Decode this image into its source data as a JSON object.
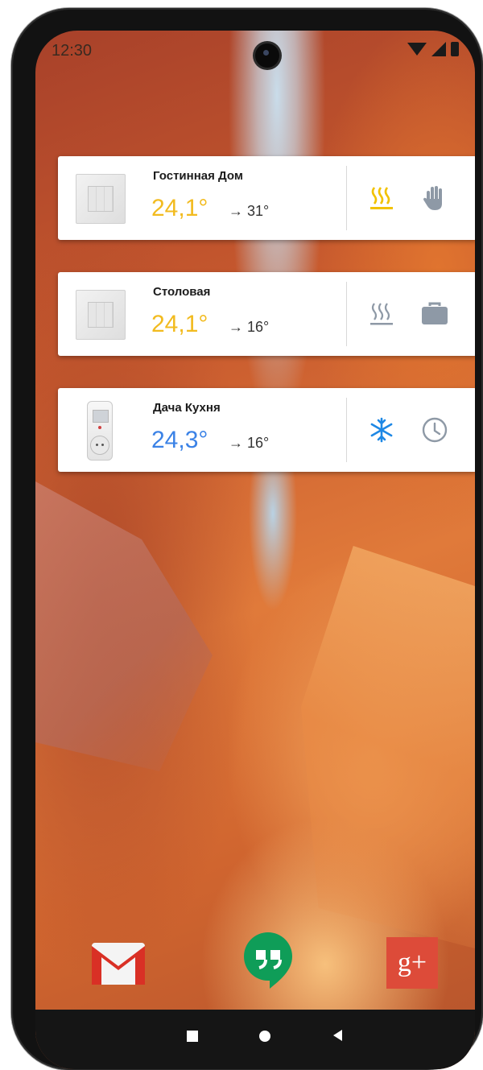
{
  "status_bar": {
    "time": "12:30",
    "icons": [
      "camera-icon",
      "wifi-icon",
      "signal-icon",
      "battery-icon"
    ]
  },
  "widgets": [
    {
      "name": "Гостинная Дом",
      "current_temp": "24,1°",
      "target_temp": "→ 31°",
      "device": "thermostat-panel",
      "mode_icon": "heating-icon",
      "mode_color": "#f2c200",
      "schedule_icon": "hand-icon",
      "temp_color": "#f2bb1f"
    },
    {
      "name": "Столовая",
      "current_temp": "24,1°",
      "target_temp": "→ 16°",
      "device": "thermostat-panel",
      "mode_icon": "heating-icon",
      "mode_color": "#8e99a6",
      "schedule_icon": "briefcase-icon",
      "temp_color": "#f2bb1f"
    },
    {
      "name": "Дача Кухня",
      "current_temp": "24,3°",
      "target_temp": "→ 16°",
      "device": "smart-plug",
      "mode_icon": "snowflake-icon",
      "mode_color": "#1e88e5",
      "schedule_icon": "clock-icon",
      "temp_color": "#3b82e6"
    }
  ],
  "dock": {
    "apps": [
      "gmail-icon",
      "hangouts-icon",
      "google-plus-icon"
    ],
    "google_plus_label": "g+"
  },
  "nav": {
    "buttons": [
      "recents-button",
      "home-button",
      "back-button"
    ]
  },
  "colors": {
    "accent_yellow": "#f2bb1f",
    "accent_blue": "#3b82e6",
    "icon_grey": "#8e99a6"
  }
}
